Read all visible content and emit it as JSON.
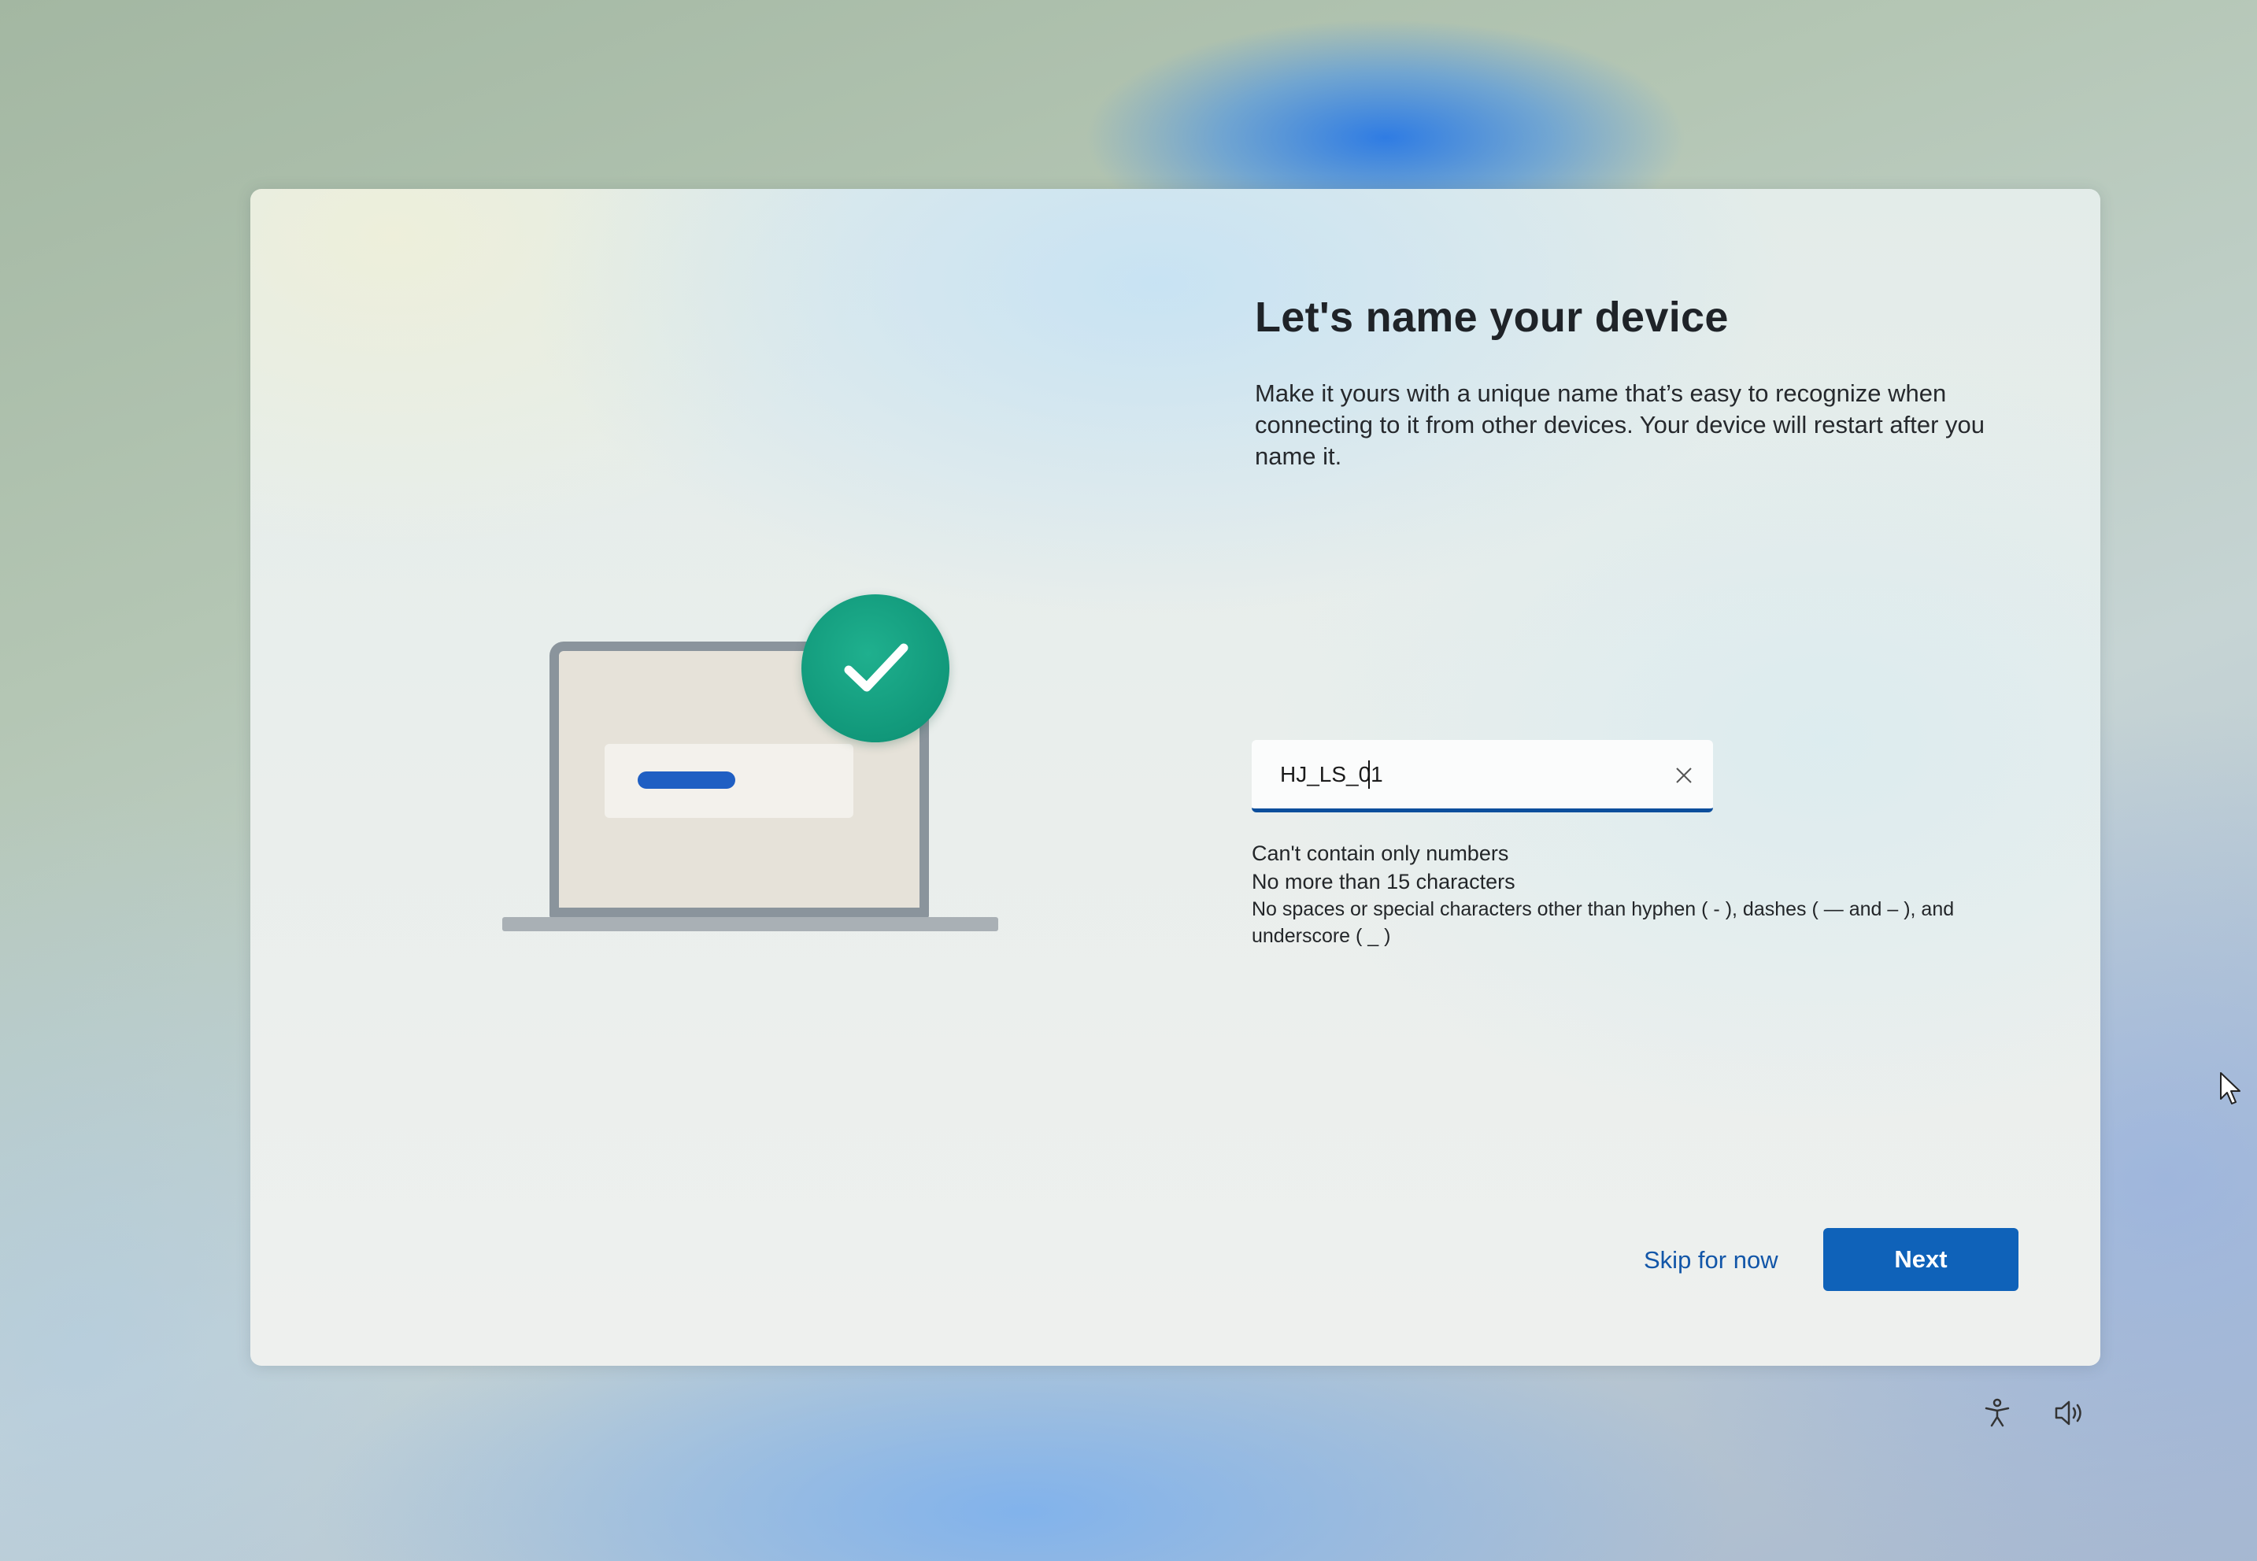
{
  "page": {
    "title": "Let's name your device",
    "description": "Make it yours with a unique name that’s easy to recognize when connecting to it from other devices. Your device will restart after you name it."
  },
  "name_field": {
    "value": "HJ_LS_01",
    "clear_icon": "close-icon"
  },
  "rules": [
    "Can't contain only numbers",
    "No more than 15 characters",
    "No spaces or special characters other than hyphen ( - ), dashes ( — and – ), and underscore ( _ )"
  ],
  "actions": {
    "skip_label": "Skip for now",
    "next_label": "Next"
  },
  "system_icons": {
    "accessibility": "accessibility-icon",
    "volume": "volume-icon"
  },
  "colors": {
    "accent": "#0f62b9",
    "check_badge": "#11987a",
    "link": "#1256a8"
  }
}
